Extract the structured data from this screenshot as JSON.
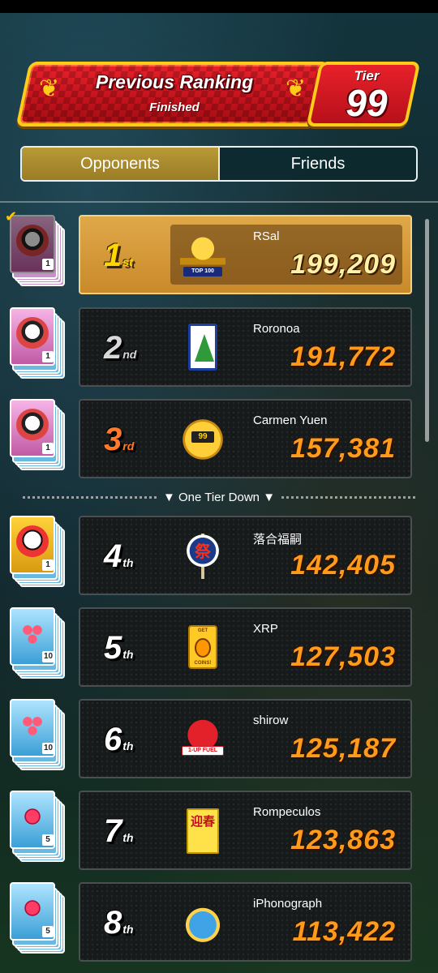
{
  "header": {
    "title": "Previous Ranking",
    "subtitle": "Finished",
    "tier_label": "Tier",
    "tier_value": "99"
  },
  "tabs": [
    {
      "label": "Opponents",
      "active": true
    },
    {
      "label": "Friends",
      "active": false
    }
  ],
  "tier_down_label": "One Tier Down",
  "rankings": [
    {
      "rank": "1",
      "suffix": "st",
      "name": "RSal",
      "score": "199,209",
      "badge": "trophy-badge",
      "badge_text": "TOP 100",
      "reward_icon": "driver-card-icon",
      "reward_count": "1",
      "claimed": true
    },
    {
      "rank": "2",
      "suffix": "nd",
      "name": "Roronoa",
      "score": "191,772",
      "badge": "christmas-tree-card-badge",
      "reward_icon": "driver-card-icon",
      "reward_count": "1"
    },
    {
      "rank": "3",
      "suffix": "rd",
      "name": "Carmen Yuen",
      "score": "157,381",
      "badge": "tier-shield-badge",
      "badge_text": "99",
      "reward_icon": "driver-card-icon",
      "reward_count": "1"
    },
    {
      "rank": "4",
      "suffix": "th",
      "name": "落合福嗣",
      "score": "142,405",
      "badge": "festival-fan-badge",
      "badge_text": "祭",
      "reward_icon": "shy-guy-card-icon",
      "reward_count": "1"
    },
    {
      "rank": "5",
      "suffix": "th",
      "name": "XRP",
      "score": "127,503",
      "badge": "get-coins-badge",
      "badge_text": "GET COINS!",
      "reward_icon": "rubies-card-icon",
      "reward_count": "10"
    },
    {
      "rank": "6",
      "suffix": "th",
      "name": "shirow",
      "score": "125,187",
      "badge": "1up-fuel-badge",
      "badge_text": "1-UP FUEL",
      "reward_icon": "rubies-card-icon",
      "reward_count": "10"
    },
    {
      "rank": "7",
      "suffix": "th",
      "name": "Rompeculos",
      "score": "123,863",
      "badge": "new-year-scroll-badge",
      "badge_text": "迎春",
      "reward_icon": "ruby-card-icon",
      "reward_count": "5"
    },
    {
      "rank": "8",
      "suffix": "th",
      "name": "iPhonograph",
      "score": "113,422",
      "badge": "dinosaur-badge",
      "reward_icon": "ruby-card-icon",
      "reward_count": "5"
    }
  ],
  "colors": {
    "banner_red": "#d0161f",
    "gold_border": "#ffcc1a",
    "score_orange": "#ff9a1a",
    "first_place_panel": "#d69a3a"
  }
}
